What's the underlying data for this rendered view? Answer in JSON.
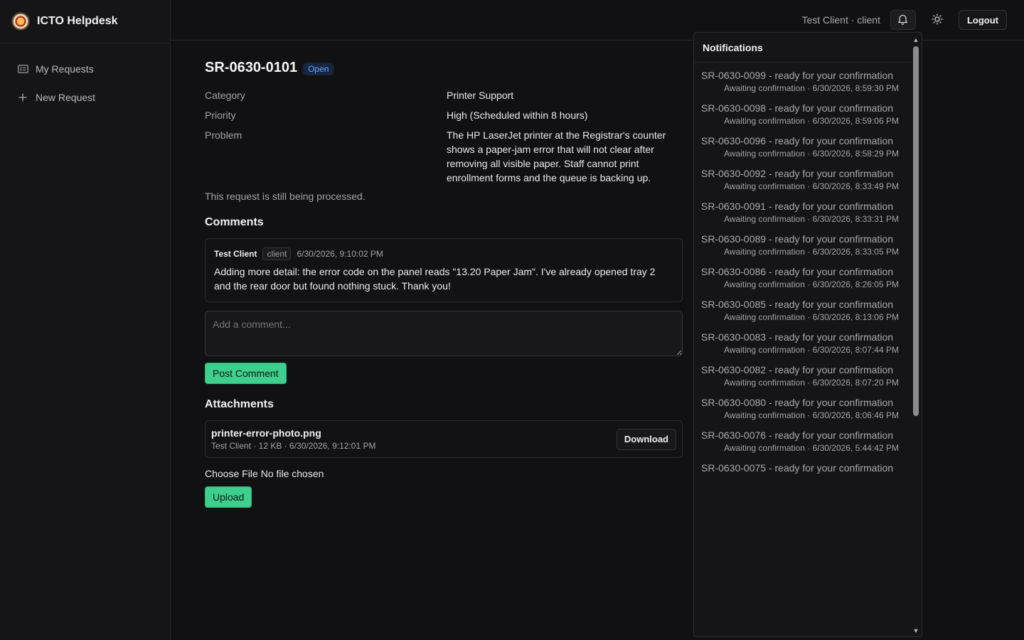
{
  "app": {
    "title": "ICTO Helpdesk"
  },
  "sidebar": {
    "items": [
      {
        "label": "My Requests",
        "icon": "ticket-icon"
      },
      {
        "label": "New Request",
        "icon": "plus-icon"
      }
    ]
  },
  "topbar": {
    "user": "Test Client · client",
    "logout_label": "Logout"
  },
  "request": {
    "id": "SR-0630-0101",
    "status": "Open",
    "details": [
      {
        "label": "Category",
        "value": "Printer Support"
      },
      {
        "label": "Priority",
        "value": "High (Scheduled within 8 hours)"
      },
      {
        "label": "Problem",
        "value": "The HP LaserJet printer at the Registrar's counter shows a paper-jam error that will not clear after removing all visible paper. Staff cannot print enrollment forms and the queue is backing up."
      }
    ],
    "processing_note": "This request is still being processed."
  },
  "comments": {
    "title": "Comments",
    "items": [
      {
        "author": "Test Client",
        "role": "client",
        "time": "6/30/2026, 9:10:02 PM",
        "text": "Adding more detail: the error code on the panel reads \"13.20 Paper Jam\". I've already opened tray 2 and the rear door but found nothing stuck. Thank you!"
      }
    ],
    "input_placeholder": "Add a comment...",
    "post_label": "Post Comment"
  },
  "attachments": {
    "title": "Attachments",
    "items": [
      {
        "name": "printer-error-photo.png",
        "meta": "Test Client · 12 KB · 6/30/2026, 9:12:01 PM"
      }
    ],
    "download_label": "Download",
    "choose_file_label": "Choose File",
    "no_file_label": "No file chosen",
    "upload_label": "Upload"
  },
  "notifications": {
    "title": "Notifications",
    "items": [
      {
        "title": "SR-0630-0099 - ready for your confirmation",
        "meta": "Awaiting confirmation · 6/30/2026, 8:59:30 PM"
      },
      {
        "title": "SR-0630-0098 - ready for your confirmation",
        "meta": "Awaiting confirmation · 6/30/2026, 8:59:06 PM"
      },
      {
        "title": "SR-0630-0096 - ready for your confirmation",
        "meta": "Awaiting confirmation · 6/30/2026, 8:58:29 PM"
      },
      {
        "title": "SR-0630-0092 - ready for your confirmation",
        "meta": "Awaiting confirmation · 6/30/2026, 8:33:49 PM"
      },
      {
        "title": "SR-0630-0091 - ready for your confirmation",
        "meta": "Awaiting confirmation · 6/30/2026, 8:33:31 PM"
      },
      {
        "title": "SR-0630-0089 - ready for your confirmation",
        "meta": "Awaiting confirmation · 6/30/2026, 8:33:05 PM"
      },
      {
        "title": "SR-0630-0086 - ready for your confirmation",
        "meta": "Awaiting confirmation · 6/30/2026, 8:26:05 PM"
      },
      {
        "title": "SR-0630-0085 - ready for your confirmation",
        "meta": "Awaiting confirmation · 6/30/2026, 8:13:06 PM"
      },
      {
        "title": "SR-0630-0083 - ready for your confirmation",
        "meta": "Awaiting confirmation · 6/30/2026, 8:07:44 PM"
      },
      {
        "title": "SR-0630-0082 - ready for your confirmation",
        "meta": "Awaiting confirmation · 6/30/2026, 8:07:20 PM"
      },
      {
        "title": "SR-0630-0080 - ready for your confirmation",
        "meta": "Awaiting confirmation · 6/30/2026, 8:06:46 PM"
      },
      {
        "title": "SR-0630-0076 - ready for your confirmation",
        "meta": "Awaiting confirmation · 6/30/2026, 5:44:42 PM"
      },
      {
        "title": "SR-0630-0075 - ready for your confirmation",
        "meta": ""
      }
    ]
  },
  "colors": {
    "accent_green": "#3ecf8e",
    "status_blue": "#6aa8ff",
    "background": "#111113"
  }
}
